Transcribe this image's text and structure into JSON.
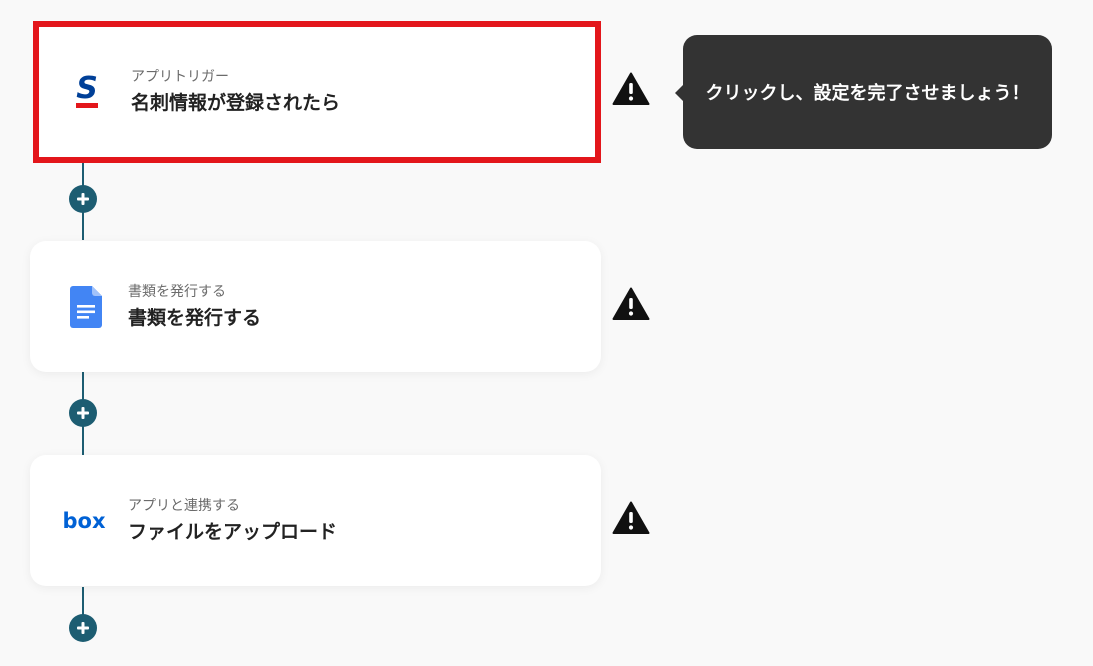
{
  "flow": {
    "steps": [
      {
        "subtitle": "アプリトリガー",
        "title": "名刺情報が登録されたら",
        "icon": "sansan-icon",
        "selected": true
      },
      {
        "subtitle": "書類を発行する",
        "title": "書類を発行する",
        "icon": "google-docs-icon",
        "selected": false
      },
      {
        "subtitle": "アプリと連携する",
        "title": "ファイルをアップロード",
        "icon": "box-icon",
        "selected": false
      }
    ],
    "box_logo_text": "box",
    "warning_icon": "warning-icon",
    "add_step_icon": "plus-icon"
  },
  "tooltip": {
    "text": "クリックし、設定を完了させましょう！"
  },
  "colors": {
    "connector": "#1d5d72",
    "selected_border": "#e3161b",
    "tooltip_bg": "#333333",
    "sansan_blue": "#004098",
    "sansan_red": "#e3161b",
    "gdocs_blue": "#4285f4",
    "box_blue": "#0061d5"
  }
}
